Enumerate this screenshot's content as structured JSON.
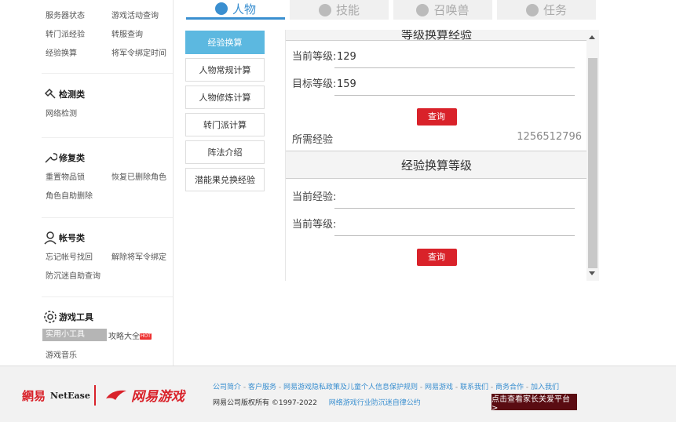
{
  "sidebar": {
    "top_rows": [
      [
        "服务器状态",
        "游戏活动查询"
      ],
      [
        "转门派经验",
        "转服查询"
      ],
      [
        "经验换算",
        "将军令绑定时间"
      ]
    ],
    "sections": [
      {
        "title": "检测类",
        "icon": "hammer-icon",
        "rows": [
          [
            "网络检测",
            ""
          ]
        ]
      },
      {
        "title": "修复类",
        "icon": "wrench-icon",
        "rows": [
          [
            "重置物品锁",
            "恢复已删除角色"
          ],
          [
            "角色自助删除",
            ""
          ]
        ]
      },
      {
        "title": "帐号类",
        "icon": "user-icon",
        "rows": [
          [
            "忘记帐号找回",
            "解除将军令绑定"
          ],
          [
            "防沉迷自助查询",
            ""
          ]
        ]
      },
      {
        "title": "游戏工具",
        "icon": "gear-icon",
        "rows": [
          [
            "实用小工具",
            "攻略大全"
          ],
          [
            "游戏音乐",
            ""
          ]
        ],
        "hot": "HOT"
      }
    ]
  },
  "tabs": [
    {
      "label": "人物",
      "icon": "person-icon",
      "active": true
    },
    {
      "label": "技能",
      "icon": "skill-icon",
      "active": false
    },
    {
      "label": "召唤兽",
      "icon": "pet-icon",
      "active": false
    },
    {
      "label": "任务",
      "icon": "task-icon",
      "active": false
    }
  ],
  "menu": [
    {
      "label": "经验换算",
      "active": true
    },
    {
      "label": "人物常规计算",
      "active": false
    },
    {
      "label": "人物修炼计算",
      "active": false
    },
    {
      "label": "转门派计算",
      "active": false
    },
    {
      "label": "阵法介绍",
      "active": false
    },
    {
      "label": "潜能果兑换经验",
      "active": false
    }
  ],
  "panel": {
    "section1_title": "等级换算经验",
    "current_level_label": "当前等级:",
    "current_level_value": "129",
    "target_level_label": "目标等级:",
    "target_level_value": "159",
    "query_label": "查询",
    "required_exp_label": "所需经验",
    "required_exp_value": "1256512796",
    "section2_title": "经验换算等级",
    "current_exp_label": "当前经验:",
    "current_exp_value": "",
    "current_level2_label": "当前等级:",
    "current_level2_value": "",
    "query2_label": "查询"
  },
  "footer": {
    "logo_cn": "網易",
    "logo_en": "NetEase",
    "logo_game": "网易游戏",
    "links": [
      "公司简介",
      "客户服务",
      "网易游戏隐私政策及儿童个人信息保护规则",
      "网易游戏",
      "联系我们",
      "商务合作",
      "加入我们"
    ],
    "copyright": "网易公司版权所有 ©1997-2022",
    "self_discipline": "网络游戏行业防沉迷自律公约",
    "parent_button": "点击查看家长关爱平台 >"
  },
  "colors": {
    "accent": "#3a8fd0",
    "menu_active": "#5cb8e0",
    "button_red": "#d9222a",
    "footer_btn": "#5a0c12"
  }
}
